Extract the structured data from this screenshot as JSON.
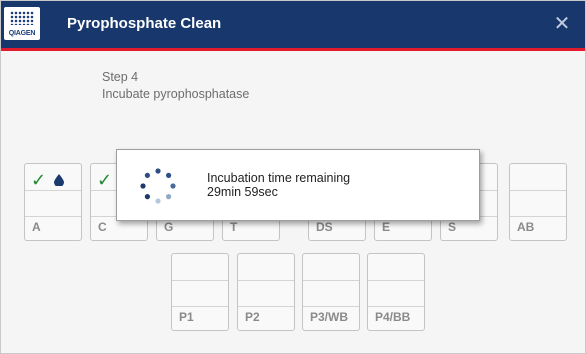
{
  "header": {
    "logo_text": "QIAGEN",
    "title": "Pyrophosphate Clean",
    "close_glyph": "✕"
  },
  "step": {
    "number": "Step 4",
    "description": "Incubate pyrophosphatase"
  },
  "row1": [
    {
      "label": "A",
      "icons": [
        "check-icon",
        "drop-icon"
      ]
    },
    {
      "label": "C",
      "icons": [
        "check-icon"
      ]
    },
    {
      "label": "G",
      "icons": []
    },
    {
      "label": "T",
      "icons": []
    },
    {
      "label": "DS",
      "icons": []
    },
    {
      "label": "E",
      "icons": []
    },
    {
      "label": "S",
      "icons": []
    },
    {
      "label": "AB",
      "icons": []
    }
  ],
  "row2": [
    {
      "label": "P1"
    },
    {
      "label": "P2"
    },
    {
      "label": "P3/WB"
    },
    {
      "label": "P4/BB"
    }
  ],
  "dialog": {
    "line1": "Incubation time remaining",
    "line2": "29min 59sec"
  },
  "colors": {
    "header": "#18386d",
    "accent": "#e21b2c",
    "check": "#1f8a2f",
    "drop": "#1b3a6e"
  }
}
